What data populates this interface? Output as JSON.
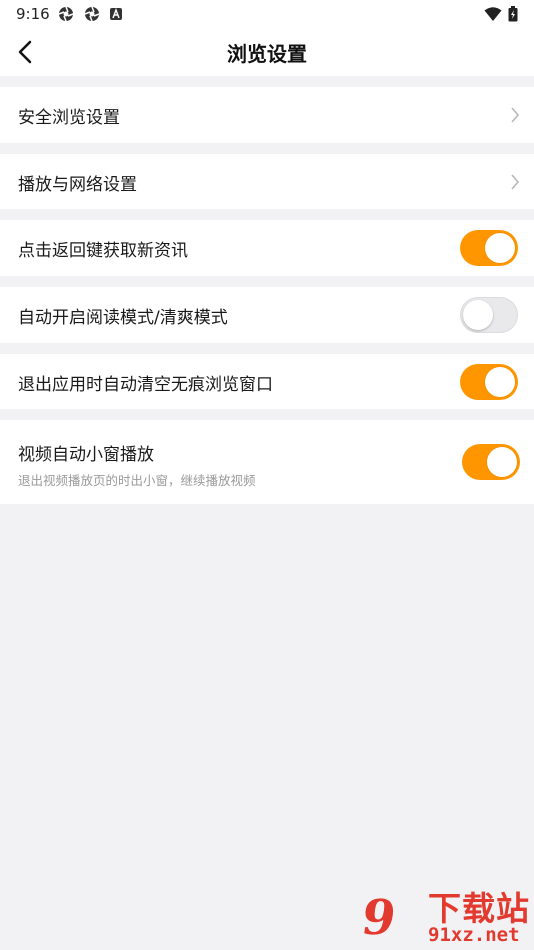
{
  "status_bar": {
    "time": "9:16"
  },
  "header": {
    "title": "浏览设置"
  },
  "rows": [
    {
      "label": "安全浏览设置"
    },
    {
      "label": "播放与网络设置"
    },
    {
      "label": "点击返回键获取新资讯",
      "toggle": "on"
    },
    {
      "label": "自动开启阅读模式/清爽模式",
      "toggle": "off"
    },
    {
      "label": "退出应用时自动清空无痕浏览窗口",
      "toggle": "on"
    },
    {
      "label": "视频自动小窗播放",
      "subtitle": "退出视频播放页的时出小窗，继续播放视频",
      "toggle": "on"
    }
  ],
  "colors": {
    "accent": "#ff9600",
    "background": "#f2f2f4",
    "watermark": "#e23a2e"
  },
  "watermark": {
    "logo": "9",
    "text": "下载站",
    "url": "91xz.net"
  }
}
